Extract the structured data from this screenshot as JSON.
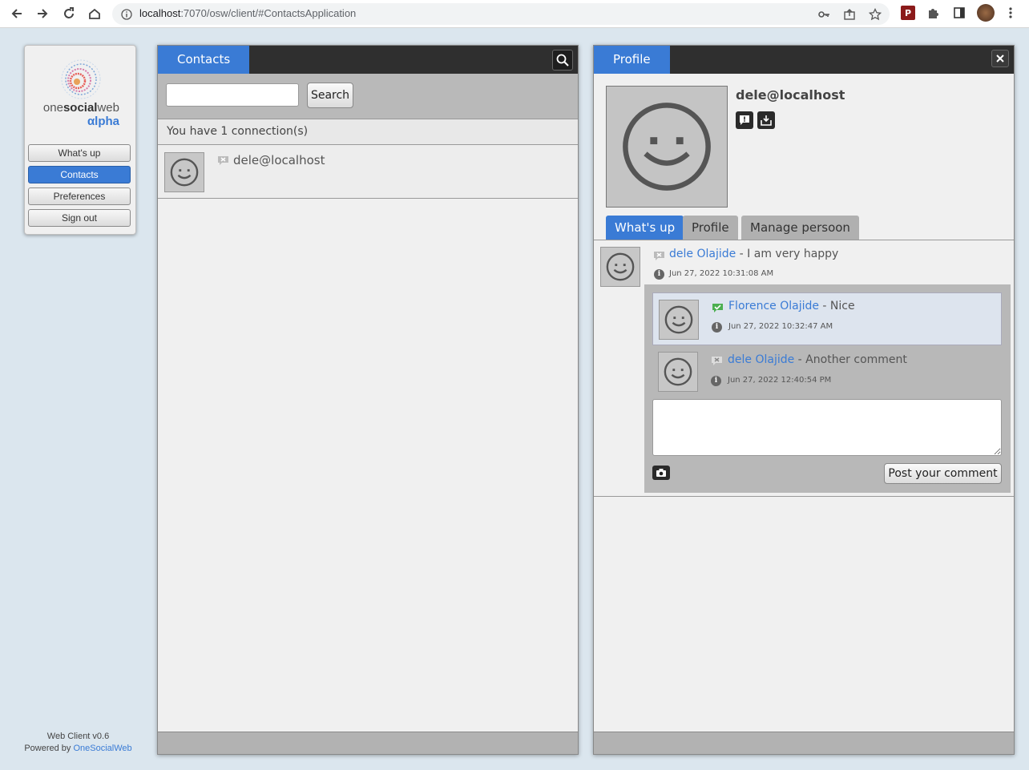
{
  "browser": {
    "url_host": "localhost",
    "url_rest": ":7070/osw/client/#ContactsApplication"
  },
  "logo": {
    "one": "one",
    "social": "social",
    "web": "web",
    "alpha": "αlpha"
  },
  "menu": {
    "items": [
      {
        "label": "What's up"
      },
      {
        "label": "Contacts"
      },
      {
        "label": "Preferences"
      },
      {
        "label": "Sign out"
      }
    ]
  },
  "footer": {
    "version": "Web Client v0.6",
    "powered_prefix": "Powered by ",
    "powered_link": "OneSocialWeb"
  },
  "contacts": {
    "tab": "Contacts",
    "search_button": "Search",
    "search_value": "",
    "connections_text": "You have 1 connection(s)",
    "list": [
      {
        "jid": "dele@localhost"
      }
    ]
  },
  "profile": {
    "tab": "Profile",
    "name": "dele@localhost",
    "sub_tabs": [
      "What's up",
      "Profile",
      "Manage persoon"
    ],
    "status": {
      "author": "dele Olajide",
      "text": " - I am very happy",
      "time": "Jun 27, 2022 10:31:08 AM"
    },
    "comments": [
      {
        "author": "Florence Olajide",
        "text": " - Nice",
        "time": "Jun 27, 2022 10:32:47 AM"
      },
      {
        "author": "dele Olajide",
        "text": " - Another comment",
        "time": "Jun 27, 2022 12:40:54 PM"
      }
    ],
    "post_button": "Post your comment"
  },
  "colors": {
    "accent": "#3a7bd5",
    "header_dark": "#2f2f2f",
    "background": "#dbe6ee"
  }
}
